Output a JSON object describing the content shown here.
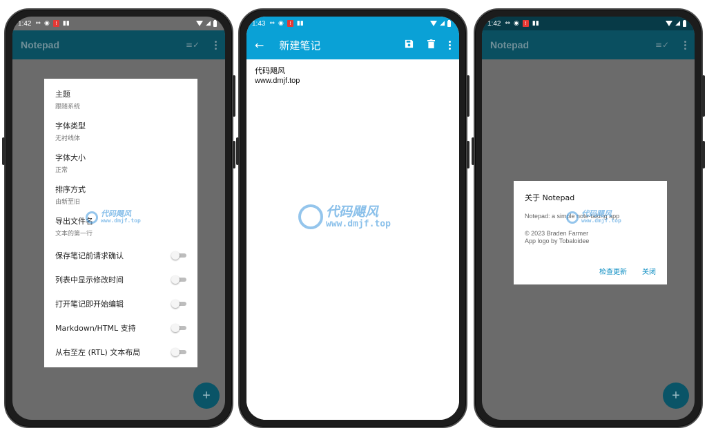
{
  "phones": [
    {
      "status": {
        "time": "1:42"
      },
      "appbar": {
        "title": "Notepad"
      },
      "settings": {
        "items": [
          {
            "title": "主题",
            "subtitle": "跟随系统"
          },
          {
            "title": "字体类型",
            "subtitle": "无衬线体"
          },
          {
            "title": "字体大小",
            "subtitle": "正常"
          },
          {
            "title": "排序方式",
            "subtitle": "由新至旧"
          },
          {
            "title": "导出文件名",
            "subtitle": "文本的第一行"
          }
        ],
        "toggles": [
          {
            "label": "保存笔记前请求确认",
            "on": false
          },
          {
            "label": "列表中显示修改时间",
            "on": false
          },
          {
            "label": "打开笔记即开始编辑",
            "on": false
          },
          {
            "label": "Markdown/HTML 支持",
            "on": false
          },
          {
            "label": "从右至左 (RTL) 文本布局",
            "on": false
          }
        ]
      },
      "fab": "+"
    },
    {
      "status": {
        "time": "1:43"
      },
      "appbar": {
        "title": "新建笔记"
      },
      "note": {
        "lines": [
          "代码飓风",
          "www.dmjf.top"
        ]
      }
    },
    {
      "status": {
        "time": "1:42"
      },
      "appbar": {
        "title": "Notepad"
      },
      "about": {
        "title": "关于 Notepad",
        "description": "Notepad: a simple note-taking app",
        "copyright": "© 2023 Braden Farmer",
        "logo_credit": "App logo by Tobaloidee",
        "check_update": "检查更新",
        "close": "关闭"
      },
      "fab": "+"
    }
  ],
  "watermark": {
    "name": "代码飓风",
    "url": "www.dmjf.top"
  },
  "colors": {
    "appbar_dim": "#0a4f60",
    "appbar_blue": "#0aa1d6",
    "accent": "#0a8cc2",
    "fab": "#0a5467"
  }
}
